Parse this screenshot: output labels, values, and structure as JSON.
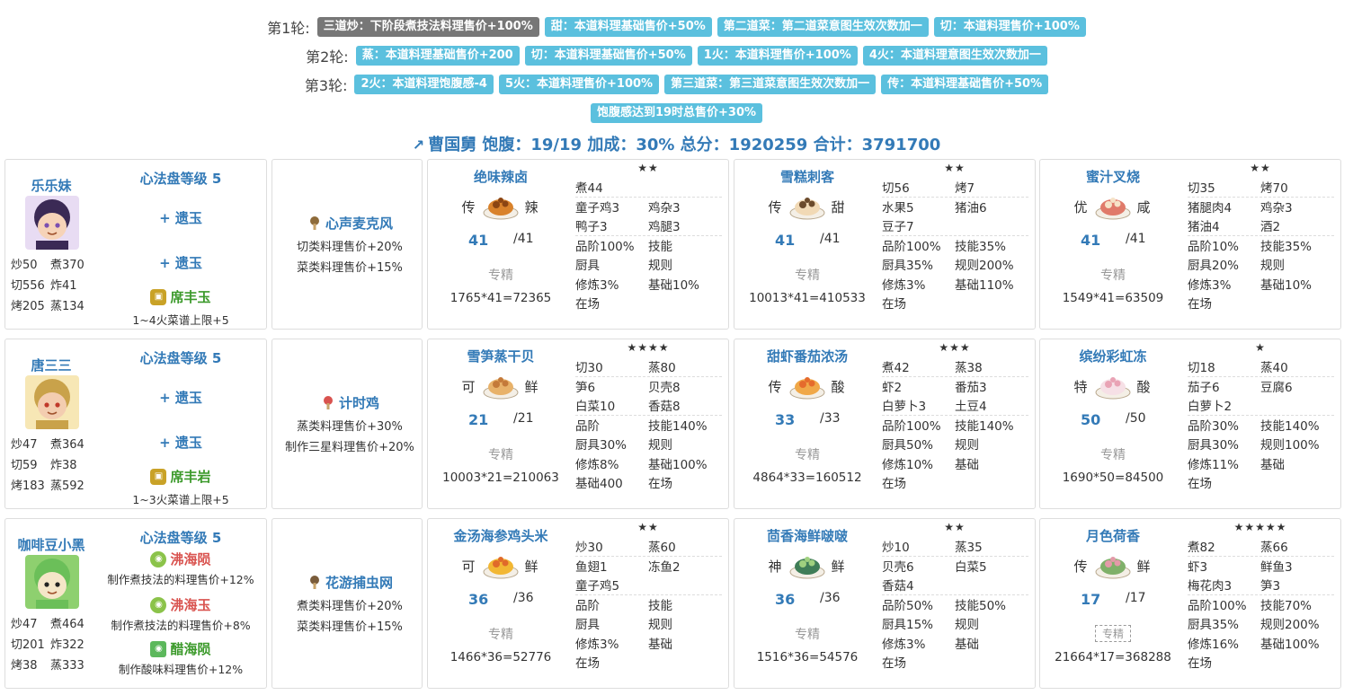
{
  "rounds": [
    {
      "label": "第1轮:",
      "tags": [
        {
          "text": "三道炒：下阶段煮技法料理售价+100%",
          "style": "grey"
        },
        {
          "text": "甜：本道料理基础售价+50%",
          "style": "blue"
        },
        {
          "text": "第二道菜：第二道菜意图生效次数加一",
          "style": "blue"
        },
        {
          "text": "切：本道料理售价+100%",
          "style": "blue"
        }
      ]
    },
    {
      "label": "第2轮:",
      "tags": [
        {
          "text": "蒸：本道料理基础售价+200",
          "style": "blue"
        },
        {
          "text": "切：本道料理基础售价+50%",
          "style": "blue"
        },
        {
          "text": "1火：本道料理售价+100%",
          "style": "blue"
        },
        {
          "text": "4火：本道料理意图生效次数加一",
          "style": "blue"
        }
      ]
    },
    {
      "label": "第3轮:",
      "tags": [
        {
          "text": "2火：本道料理饱腹感-4",
          "style": "blue"
        },
        {
          "text": "5火：本道料理售价+100%",
          "style": "blue"
        },
        {
          "text": "第三道菜：第三道菜意图生效次数加一",
          "style": "blue"
        },
        {
          "text": "传：本道料理基础售价+50%",
          "style": "blue"
        }
      ]
    },
    {
      "label": "",
      "tags": [
        {
          "text": "饱腹感达到19时总售价+30%",
          "style": "blue"
        }
      ]
    }
  ],
  "summary": "曹国舅 饱腹：19/19 加成：30% 总分：1920259 合计：3791700",
  "rows": [
    {
      "chef": {
        "name": "乐乐妹",
        "skills": [
          "炒50",
          "煮370",
          "切556",
          "炸41",
          "烤205",
          "蒸134"
        ],
        "level": "心法盘等级 5",
        "slots": [
          {
            "kind": "plus",
            "text": "+ 遗玉"
          },
          {
            "kind": "plus",
            "text": "+ 遗玉"
          },
          {
            "kind": "jade",
            "text": "席丰玉",
            "color": "#3c9a2b",
            "icon": "yellow-hex",
            "desc": ""
          }
        ],
        "note": "1~4火菜谱上限+5"
      },
      "equip": {
        "name": "心声麦克风",
        "icon": "microphone-icon",
        "lines": [
          "切类料理售价+20%",
          "菜类料理售价+15%"
        ]
      },
      "recipes": [
        {
          "name": "绝味辣卤",
          "rank": "传",
          "flavor": "辣",
          "qty": "41",
          "max": "/41",
          "zj": "专精",
          "formula": "1765*41=72365",
          "stars": "★★",
          "icon": "braised-dish",
          "rows": [
            [
              "煮44",
              ""
            ],
            [
              "童子鸡3",
              "鸡杂3"
            ],
            [
              "鸭子3",
              "鸡腿3"
            ],
            [
              "品阶100%",
              "技能"
            ],
            [
              "厨具",
              "规则"
            ],
            [
              "修炼3%",
              "基础10%"
            ],
            [
              "在场",
              ""
            ]
          ]
        },
        {
          "name": "雪糕刺客",
          "rank": "传",
          "flavor": "甜",
          "qty": "41",
          "max": "/41",
          "zj": "专精",
          "formula": "10013*41=410533",
          "stars": "★★",
          "icon": "icecream-dish",
          "rows": [
            [
              "切56",
              "烤7"
            ],
            [
              "水果5",
              "猪油6"
            ],
            [
              "豆子7",
              ""
            ],
            [
              "品阶100%",
              "技能35%"
            ],
            [
              "厨具35%",
              "规则200%"
            ],
            [
              "修炼3%",
              "基础110%"
            ],
            [
              "在场",
              ""
            ]
          ]
        },
        {
          "name": "蜜汁叉烧",
          "rank": "优",
          "flavor": "咸",
          "qty": "41",
          "max": "/41",
          "zj": "专精",
          "formula": "1549*41=63509",
          "stars": "★★",
          "icon": "pork-dish",
          "rows": [
            [
              "切35",
              "烤70"
            ],
            [
              "猪腿肉4",
              "鸡杂3"
            ],
            [
              "猪油4",
              "酒2"
            ],
            [
              "品阶10%",
              "技能35%"
            ],
            [
              "厨具20%",
              "规则"
            ],
            [
              "修炼3%",
              "基础10%"
            ],
            [
              "在场",
              ""
            ]
          ]
        }
      ]
    },
    {
      "chef": {
        "name": "唐三三",
        "skills": [
          "炒47",
          "煮364",
          "切59",
          "炸38",
          "烤183",
          "蒸592"
        ],
        "level": "心法盘等级 5",
        "slots": [
          {
            "kind": "plus",
            "text": "+ 遗玉"
          },
          {
            "kind": "plus",
            "text": "+ 遗玉"
          },
          {
            "kind": "jade",
            "text": "席丰岩",
            "color": "#3c9a2b",
            "icon": "yellow-hex",
            "desc": ""
          }
        ],
        "note": "1~3火菜谱上限+5"
      },
      "equip": {
        "name": "计时鸡",
        "icon": "chicken-timer-icon",
        "lines": [
          "蒸类料理售价+30%",
          "制作三星料理售价+20%"
        ]
      },
      "recipes": [
        {
          "name": "雪笋蒸干贝",
          "rank": "可",
          "flavor": "鲜",
          "qty": "21",
          "max": "/21",
          "zj": "专精",
          "formula": "10003*21=210063",
          "stars": "★★★★",
          "icon": "scallop-dish",
          "rows": [
            [
              "切30",
              "蒸80"
            ],
            [
              "笋6",
              "贝壳8"
            ],
            [
              "白菜10",
              "香菇8"
            ],
            [
              "品阶",
              "技能140%"
            ],
            [
              "厨具30%",
              "规则"
            ],
            [
              "修炼8%",
              "基础100%"
            ],
            [
              "基础400",
              "在场"
            ]
          ]
        },
        {
          "name": "甜虾番茄浓汤",
          "rank": "传",
          "flavor": "酸",
          "qty": "33",
          "max": "/33",
          "zj": "专精",
          "formula": "4864*33=160512",
          "stars": "★★★",
          "icon": "soup-dish",
          "rows": [
            [
              "煮42",
              "蒸38"
            ],
            [
              "虾2",
              "番茄3"
            ],
            [
              "白萝卜3",
              "土豆4"
            ],
            [
              "品阶100%",
              "技能140%"
            ],
            [
              "厨具50%",
              "规则"
            ],
            [
              "修炼10%",
              "基础"
            ],
            [
              "在场",
              ""
            ]
          ]
        },
        {
          "name": "缤纷彩虹冻",
          "rank": "特",
          "flavor": "酸",
          "qty": "50",
          "max": "/50",
          "zj": "专精",
          "formula": "1690*50=84500",
          "stars": "★",
          "icon": "jelly-dish",
          "rows": [
            [
              "切18",
              "蒸40"
            ],
            [
              "茄子6",
              "豆腐6"
            ],
            [
              "白萝卜2",
              ""
            ],
            [
              "品阶30%",
              "技能140%"
            ],
            [
              "厨具30%",
              "规则100%"
            ],
            [
              "修炼11%",
              "基础"
            ],
            [
              "在场",
              ""
            ]
          ]
        }
      ]
    },
    {
      "chef": {
        "name": "咖啡豆小黑",
        "skills": [
          "炒47",
          "煮464",
          "切201",
          "炸322",
          "烤38",
          "蒸333"
        ],
        "level": "心法盘等级 5",
        "slots": [
          {
            "kind": "jade",
            "text": "沸海陨",
            "color": "#d9534f",
            "icon": "green-round",
            "desc": "制作煮技法的料理售价+12%"
          },
          {
            "kind": "jade",
            "text": "沸海玉",
            "color": "#d9534f",
            "icon": "green-round",
            "desc": "制作煮技法的料理售价+8%"
          },
          {
            "kind": "jade",
            "text": "醋海陨",
            "color": "#3c9a2b",
            "icon": "green-square",
            "desc": "制作酸味料理售价+12%"
          }
        ],
        "note": ""
      },
      "equip": {
        "name": "花游捕虫网",
        "icon": "bug-net-icon",
        "lines": [
          "煮类料理售价+20%",
          "菜类料理售价+15%"
        ]
      },
      "recipes": [
        {
          "name": "金汤海参鸡头米",
          "rank": "可",
          "flavor": "鲜",
          "qty": "36",
          "max": "/36",
          "zj": "专精",
          "formula": "1466*36=52776",
          "stars": "★★",
          "icon": "golden-soup-dish",
          "rows": [
            [
              "炒30",
              "蒸60"
            ],
            [
              "鱼翅1",
              "冻鱼2"
            ],
            [
              "童子鸡5",
              ""
            ],
            [
              "品阶",
              "技能"
            ],
            [
              "厨具",
              "规则"
            ],
            [
              "修炼3%",
              "基础"
            ],
            [
              "在场",
              ""
            ]
          ]
        },
        {
          "name": "茴香海鲜啵啵",
          "rank": "神",
          "flavor": "鲜",
          "qty": "36",
          "max": "/36",
          "zj": "专精",
          "formula": "1516*36=54576",
          "stars": "★★",
          "icon": "seafood-bowl",
          "rows": [
            [
              "炒10",
              "蒸35"
            ],
            [
              "贝壳6",
              "白菜5"
            ],
            [
              "香菇4",
              ""
            ],
            [
              "品阶50%",
              "技能50%"
            ],
            [
              "厨具15%",
              "规则"
            ],
            [
              "修炼3%",
              "基础"
            ],
            [
              "在场",
              ""
            ]
          ]
        },
        {
          "name": "月色荷香",
          "rank": "传",
          "flavor": "鲜",
          "qty": "17",
          "max": "/17",
          "zj": "专精",
          "formula": "21664*17=368288",
          "stars": "★★★★★",
          "icon": "lotus-dish",
          "rows": [
            [
              "煮82",
              "蒸66"
            ],
            [
              "虾3",
              "鲜鱼3"
            ],
            [
              "梅花肉3",
              "笋3"
            ],
            [
              "品阶100%",
              "技能70%"
            ],
            [
              "厨具35%",
              "规则200%"
            ],
            [
              "修炼16%",
              "基础100%"
            ],
            [
              "在场",
              ""
            ]
          ]
        }
      ]
    }
  ]
}
